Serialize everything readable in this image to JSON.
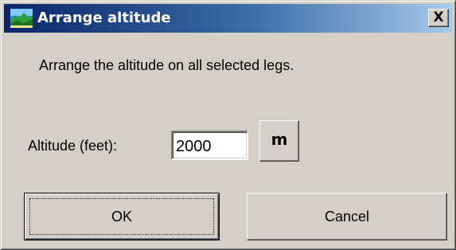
{
  "window": {
    "title": "Arrange altitude",
    "icon": "landscape-icon",
    "close_label": "X"
  },
  "body": {
    "message": "Arrange the altitude on all selected legs.",
    "altitude": {
      "label": "Altitude (feet):",
      "value": "2000",
      "unit_button_label": "m"
    }
  },
  "buttons": {
    "ok_label": "OK",
    "cancel_label": "Cancel"
  },
  "colors": {
    "titlebar_start": "#0a246a",
    "titlebar_end": "#a6caf0",
    "dialog_face": "#d4d0c8"
  }
}
